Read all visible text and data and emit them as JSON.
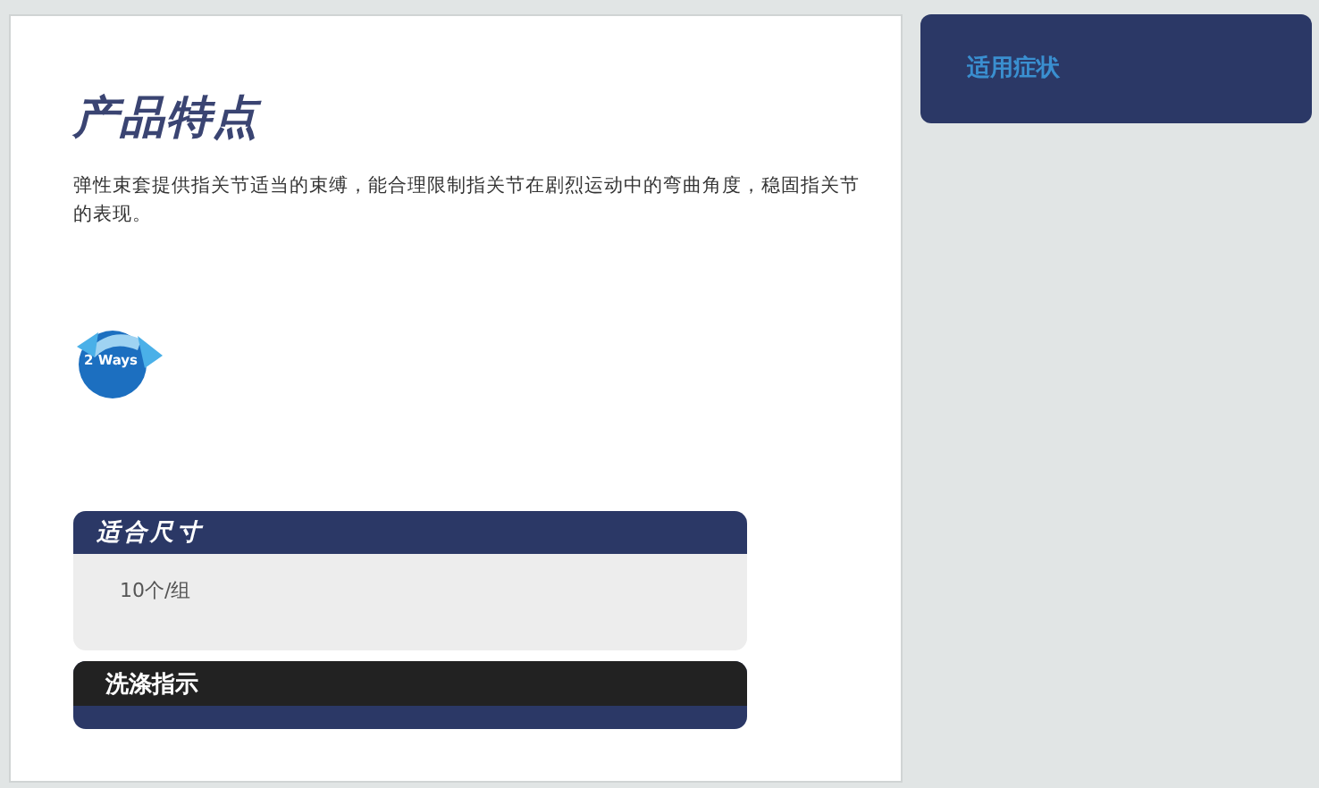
{
  "main": {
    "title": "产品特点",
    "description": "弹性束套提供指关节适当的束缚，能合理限制指关节在剧烈运动中的弯曲角度，稳固指关节的表现。",
    "badge": {
      "label": "2 Ways"
    },
    "sections": [
      {
        "title": "适合尺寸",
        "kind": "open",
        "body": "10个/组"
      },
      {
        "title": "洗涤指示",
        "kind": "closed"
      }
    ]
  },
  "sidebar": {
    "title": "适用症状"
  }
}
